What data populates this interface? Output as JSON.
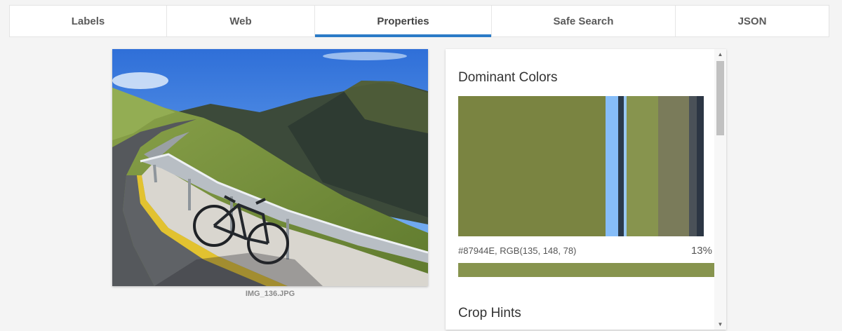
{
  "tabs": [
    {
      "label": "Labels"
    },
    {
      "label": "Web"
    },
    {
      "label": "Properties",
      "active": true
    },
    {
      "label": "Safe Search"
    },
    {
      "label": "JSON"
    }
  ],
  "image": {
    "filename": "IMG_136.JPG"
  },
  "properties": {
    "dominant_colors_title": "Dominant Colors",
    "swatches": [
      {
        "color": "#7a8441",
        "share": 0.6
      },
      {
        "color": "#86bdf8",
        "share": 0.05
      },
      {
        "color": "#2a3a4c",
        "share": 0.025
      },
      {
        "color": "#9ac8f3",
        "share": 0.01
      },
      {
        "color": "#87944e",
        "share": 0.13
      },
      {
        "color": "#7a7b5a",
        "share": 0.125
      },
      {
        "color": "#4a5158",
        "share": 0.03
      },
      {
        "color": "#2c3644",
        "share": 0.03
      }
    ],
    "selected_color": {
      "label": "#87944E,  RGB(135, 148, 78)",
      "hex": "#87944E",
      "percent": "13%"
    },
    "crop_hints_title": "Crop Hints"
  },
  "scrollbar": {
    "up_icon": "▲",
    "down_icon": "▼"
  }
}
